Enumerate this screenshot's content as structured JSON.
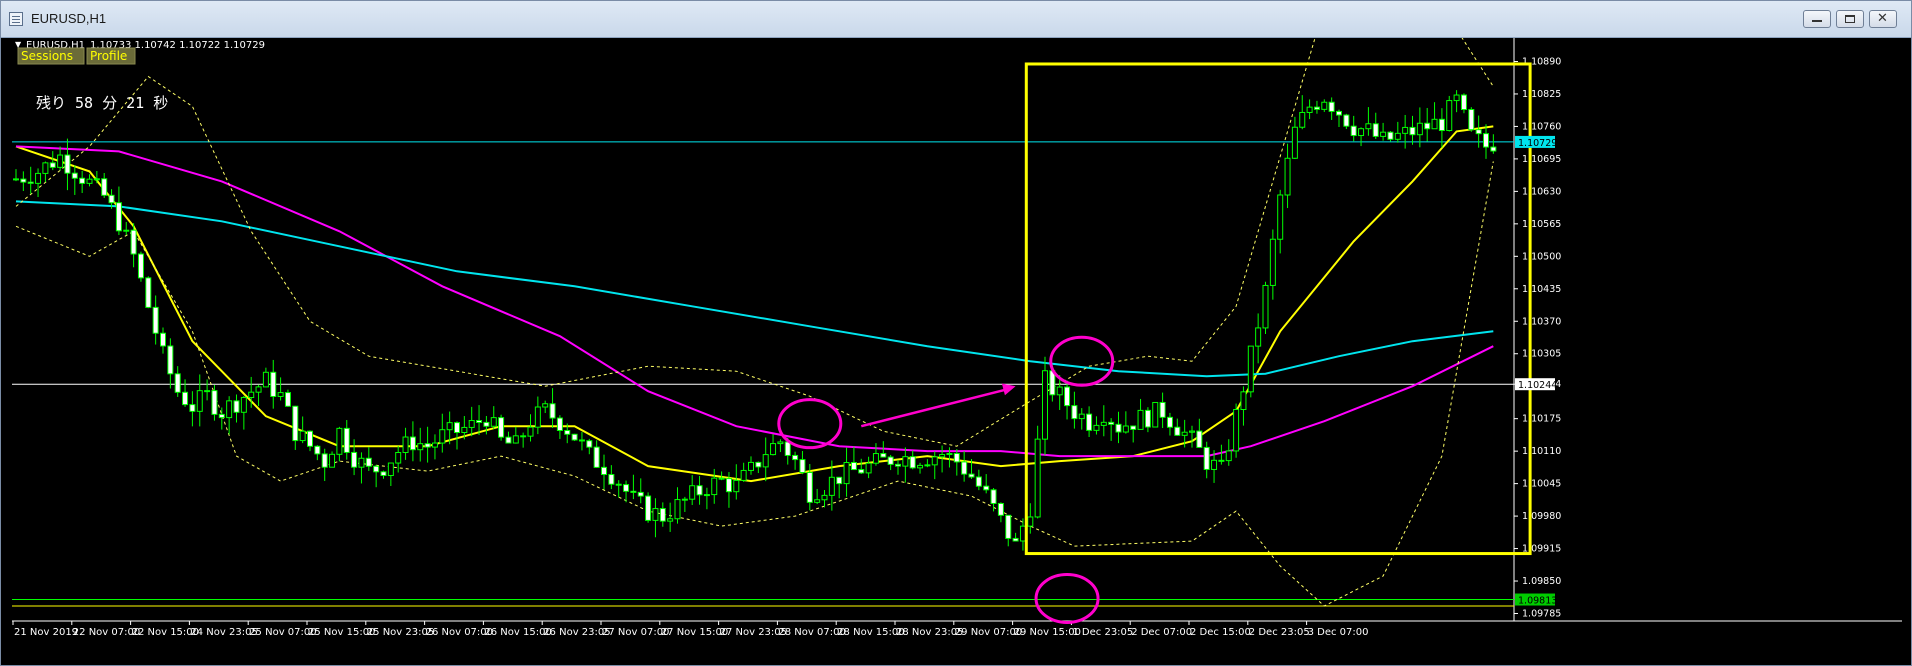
{
  "window": {
    "title": "EURUSD,H1"
  },
  "header": {
    "symbol_tf": "EURUSD,H1",
    "quote": "1.10733 1.10742 1.10722 1.10729",
    "buttons": [
      "Sessions",
      "Profile"
    ],
    "countdown": "残り 58 分 21 秒"
  },
  "colors": {
    "background": "#000000",
    "grid_axis": "#ffffff",
    "bull_candle": "#ffffff",
    "bear_candle": "#00ff00",
    "ma_yellow": "#ffff00",
    "ma_magenta": "#ff00ff",
    "ma_cyan": "#00e5ee",
    "bands": "#ffff66",
    "highlight_box": "#ffff00",
    "markup": "#ff00cc"
  },
  "chart_data": {
    "type": "candlestick",
    "price_axis": {
      "ticks": [
        "1.10890",
        "1.10825",
        "1.10760",
        "1.10695",
        "1.10630",
        "1.10565",
        "1.10500",
        "1.10435",
        "1.10370",
        "1.10305",
        "1.10244",
        "1.10175",
        "1.10110",
        "1.10045",
        "1.09980",
        "1.09915",
        "1.09850",
        "1.09785"
      ],
      "ylim": [
        1.0977,
        1.10925
      ]
    },
    "time_axis": {
      "ticks": [
        "21 Nov 2019",
        "22 Nov 07:00",
        "22 Nov 15:00",
        "24 Nov 23:05",
        "25 Nov 07:00",
        "25 Nov 15:00",
        "25 Nov 23:05",
        "26 Nov 07:00",
        "26 Nov 15:00",
        "26 Nov 23:05",
        "27 Nov 07:00",
        "27 Nov 15:00",
        "27 Nov 23:05",
        "28 Nov 07:00",
        "28 Nov 15:00",
        "28 Nov 23:05",
        "29 Nov 07:00",
        "29 Nov 15:00",
        "1 Dec 23:05",
        "2 Dec 07:00",
        "2 Dec 15:00",
        "2 Dec 23:05",
        "3 Dec 07:00"
      ],
      "bars_per_tick": 8
    },
    "horizontal_lines": [
      {
        "price": 1.10729,
        "label": "1.10729",
        "color": "#00e5ee"
      },
      {
        "price": 1.10244,
        "label": "1.10244",
        "color": "#ffffff"
      },
      {
        "price": 1.09813,
        "label": "1.09813",
        "color": "#00ff00"
      },
      {
        "price": 1.098,
        "label": "1.09800",
        "color": "#ffff00"
      }
    ],
    "ohlc_close_path": [
      [
        0,
        1.10655
      ],
      [
        3,
        1.1067
      ],
      [
        6,
        1.107
      ],
      [
        9,
        1.1066
      ],
      [
        12,
        1.1062
      ],
      [
        14,
        1.1057
      ],
      [
        16,
        1.105
      ],
      [
        18,
        1.104
      ],
      [
        20,
        1.103
      ],
      [
        22,
        1.1023
      ],
      [
        24,
        1.102
      ],
      [
        26,
        1.1022
      ],
      [
        28,
        1.1019
      ],
      [
        30,
        1.1021
      ],
      [
        32,
        1.1023
      ],
      [
        34,
        1.1025
      ],
      [
        36,
        1.1022
      ],
      [
        38,
        1.1015
      ],
      [
        40,
        1.1012
      ],
      [
        42,
        1.1009
      ],
      [
        44,
        1.1015
      ],
      [
        46,
        1.101
      ],
      [
        48,
        1.1007
      ],
      [
        50,
        1.1008
      ],
      [
        52,
        1.1011
      ],
      [
        54,
        1.1013
      ],
      [
        56,
        1.1012
      ],
      [
        58,
        1.1014
      ],
      [
        60,
        1.1015
      ],
      [
        62,
        1.1016
      ],
      [
        64,
        1.1018
      ],
      [
        66,
        1.1013
      ],
      [
        68,
        1.1012
      ],
      [
        70,
        1.1017
      ],
      [
        72,
        1.1019
      ],
      [
        74,
        1.1017
      ],
      [
        76,
        1.1014
      ],
      [
        78,
        1.101
      ],
      [
        80,
        1.1008
      ],
      [
        82,
        1.1005
      ],
      [
        84,
        1.1001
      ],
      [
        86,
        1.0999
      ],
      [
        88,
        1.0998
      ],
      [
        90,
        1.1
      ],
      [
        92,
        1.1002
      ],
      [
        94,
        1.1004
      ],
      [
        96,
        1.1005
      ],
      [
        98,
        1.1004
      ],
      [
        100,
        1.1007
      ],
      [
        102,
        1.1011
      ],
      [
        104,
        1.1013
      ],
      [
        106,
        1.1009
      ],
      [
        108,
        1.1003
      ],
      [
        110,
        1.1004
      ],
      [
        112,
        1.1006
      ],
      [
        114,
        1.1007
      ],
      [
        116,
        1.1008
      ],
      [
        118,
        1.1009
      ],
      [
        120,
        1.101
      ],
      [
        122,
        1.10095
      ],
      [
        124,
        1.101
      ],
      [
        126,
        1.10105
      ],
      [
        128,
        1.1009
      ],
      [
        130,
        1.1006
      ],
      [
        132,
        1.1002
      ],
      [
        134,
        1.0997
      ],
      [
        136,
        1.0992
      ],
      [
        138,
        1.1
      ],
      [
        140,
        1.1025
      ],
      [
        142,
        1.1022
      ],
      [
        144,
        1.1019
      ],
      [
        146,
        1.1017
      ],
      [
        148,
        1.1019
      ],
      [
        150,
        1.1016
      ],
      [
        152,
        1.1017
      ],
      [
        154,
        1.1018
      ],
      [
        156,
        1.1019
      ],
      [
        158,
        1.1016
      ],
      [
        160,
        1.1013
      ],
      [
        162,
        1.1009
      ],
      [
        164,
        1.1007
      ],
      [
        166,
        1.1018
      ],
      [
        168,
        1.103
      ],
      [
        170,
        1.1043
      ],
      [
        172,
        1.1062
      ],
      [
        174,
        1.1075
      ],
      [
        176,
        1.108
      ],
      [
        178,
        1.1082
      ],
      [
        180,
        1.1079
      ],
      [
        182,
        1.1076
      ],
      [
        184,
        1.1075
      ],
      [
        186,
        1.1073
      ],
      [
        188,
        1.1074
      ],
      [
        190,
        1.1075
      ],
      [
        192,
        1.1076
      ],
      [
        194,
        1.1077
      ],
      [
        196,
        1.1081
      ],
      [
        198,
        1.1074
      ],
      [
        200,
        1.1072
      ],
      [
        201,
        1.10729
      ]
    ],
    "series": [
      {
        "name": "",
        "color": "#ffff00",
        "points": [
          [
            0,
            1.1072
          ],
          [
            10,
            1.1067
          ],
          [
            16,
            1.1056
          ],
          [
            24,
            1.1033
          ],
          [
            34,
            1.1018
          ],
          [
            44,
            1.1012
          ],
          [
            56,
            1.1012
          ],
          [
            66,
            1.1016
          ],
          [
            76,
            1.1016
          ],
          [
            86,
            1.1008
          ],
          [
            100,
            1.1005
          ],
          [
            112,
            1.1008
          ],
          [
            124,
            1.101
          ],
          [
            134,
            1.1008
          ],
          [
            142,
            1.1009
          ],
          [
            152,
            1.101
          ],
          [
            160,
            1.1013
          ],
          [
            166,
            1.1019
          ],
          [
            172,
            1.1035
          ],
          [
            182,
            1.1053
          ],
          [
            190,
            1.1065
          ],
          [
            196,
            1.1075
          ],
          [
            201,
            1.1076
          ]
        ]
      },
      {
        "name": "",
        "color": "#ff00ff",
        "points": [
          [
            0,
            1.1072
          ],
          [
            14,
            1.1071
          ],
          [
            28,
            1.1065
          ],
          [
            44,
            1.1055
          ],
          [
            58,
            1.1044
          ],
          [
            74,
            1.1034
          ],
          [
            86,
            1.1023
          ],
          [
            98,
            1.1016
          ],
          [
            112,
            1.1012
          ],
          [
            124,
            1.1011
          ],
          [
            134,
            1.1011
          ],
          [
            142,
            1.101
          ],
          [
            152,
            1.101
          ],
          [
            162,
            1.101
          ],
          [
            168,
            1.1012
          ],
          [
            178,
            1.1017
          ],
          [
            190,
            1.1024
          ],
          [
            201,
            1.1032
          ]
        ]
      },
      {
        "name": "",
        "color": "#00e5ee",
        "points": [
          [
            0,
            1.1061
          ],
          [
            14,
            1.106
          ],
          [
            28,
            1.1057
          ],
          [
            44,
            1.1052
          ],
          [
            60,
            1.1047
          ],
          [
            76,
            1.1044
          ],
          [
            92,
            1.104
          ],
          [
            108,
            1.1036
          ],
          [
            124,
            1.1032
          ],
          [
            138,
            1.1029
          ],
          [
            150,
            1.1027
          ],
          [
            162,
            1.1026
          ],
          [
            170,
            1.10265
          ],
          [
            180,
            1.103
          ],
          [
            190,
            1.1033
          ],
          [
            201,
            1.1035
          ]
        ]
      },
      {
        "name": "",
        "color": "#ffff66",
        "points": [
          [
            0,
            1.1056
          ],
          [
            10,
            1.105
          ],
          [
            16,
            1.1055
          ],
          [
            24,
            1.1035
          ],
          [
            30,
            1.101
          ],
          [
            36,
            1.1005
          ],
          [
            44,
            1.1009
          ],
          [
            56,
            1.1007
          ],
          [
            66,
            1.101
          ],
          [
            76,
            1.1006
          ],
          [
            86,
            1.0999
          ],
          [
            96,
            1.0996
          ],
          [
            106,
            1.0998
          ],
          [
            120,
            1.1005
          ],
          [
            130,
            1.1002
          ],
          [
            138,
            1.0996
          ],
          [
            144,
            1.0992
          ],
          [
            160,
            1.0993
          ],
          [
            166,
            1.0999
          ],
          [
            172,
            1.0988
          ],
          [
            178,
            1.098
          ],
          [
            186,
            1.0986
          ],
          [
            194,
            1.101
          ],
          [
            201,
            1.1069
          ]
        ]
      },
      {
        "name": "",
        "color": "#ffff66",
        "points": [
          [
            0,
            1.106
          ],
          [
            10,
            1.1072
          ],
          [
            18,
            1.1086
          ],
          [
            24,
            1.108
          ],
          [
            32,
            1.1055
          ],
          [
            40,
            1.1037
          ],
          [
            48,
            1.103
          ],
          [
            60,
            1.1027
          ],
          [
            72,
            1.1024
          ],
          [
            86,
            1.1028
          ],
          [
            98,
            1.1027
          ],
          [
            108,
            1.1022
          ],
          [
            118,
            1.1015
          ],
          [
            128,
            1.1012
          ],
          [
            138,
            1.1021
          ],
          [
            146,
            1.1028
          ],
          [
            154,
            1.103
          ],
          [
            160,
            1.1029
          ],
          [
            166,
            1.104
          ],
          [
            172,
            1.107
          ],
          [
            178,
            1.11
          ],
          [
            186,
            1.1115
          ],
          [
            194,
            1.11
          ],
          [
            201,
            1.1084
          ]
        ]
      }
    ],
    "annotations": [
      {
        "kind": "rectangle",
        "color": "#ffff00",
        "x_range": [
          138,
          206
        ],
        "y_range": [
          1.09905,
          1.10885
        ]
      },
      {
        "kind": "ellipse",
        "color": "#ff00cc",
        "center": [
          108,
          1.10165
        ]
      },
      {
        "kind": "ellipse",
        "color": "#ff00cc",
        "center": [
          145,
          1.1029
        ]
      },
      {
        "kind": "ellipse",
        "color": "#ff00cc",
        "center": [
          143,
          1.09815
        ]
      },
      {
        "kind": "arrow",
        "color": "#ff00cc",
        "from": [
          115,
          1.1016
        ],
        "to": [
          136,
          1.1024
        ]
      }
    ]
  }
}
